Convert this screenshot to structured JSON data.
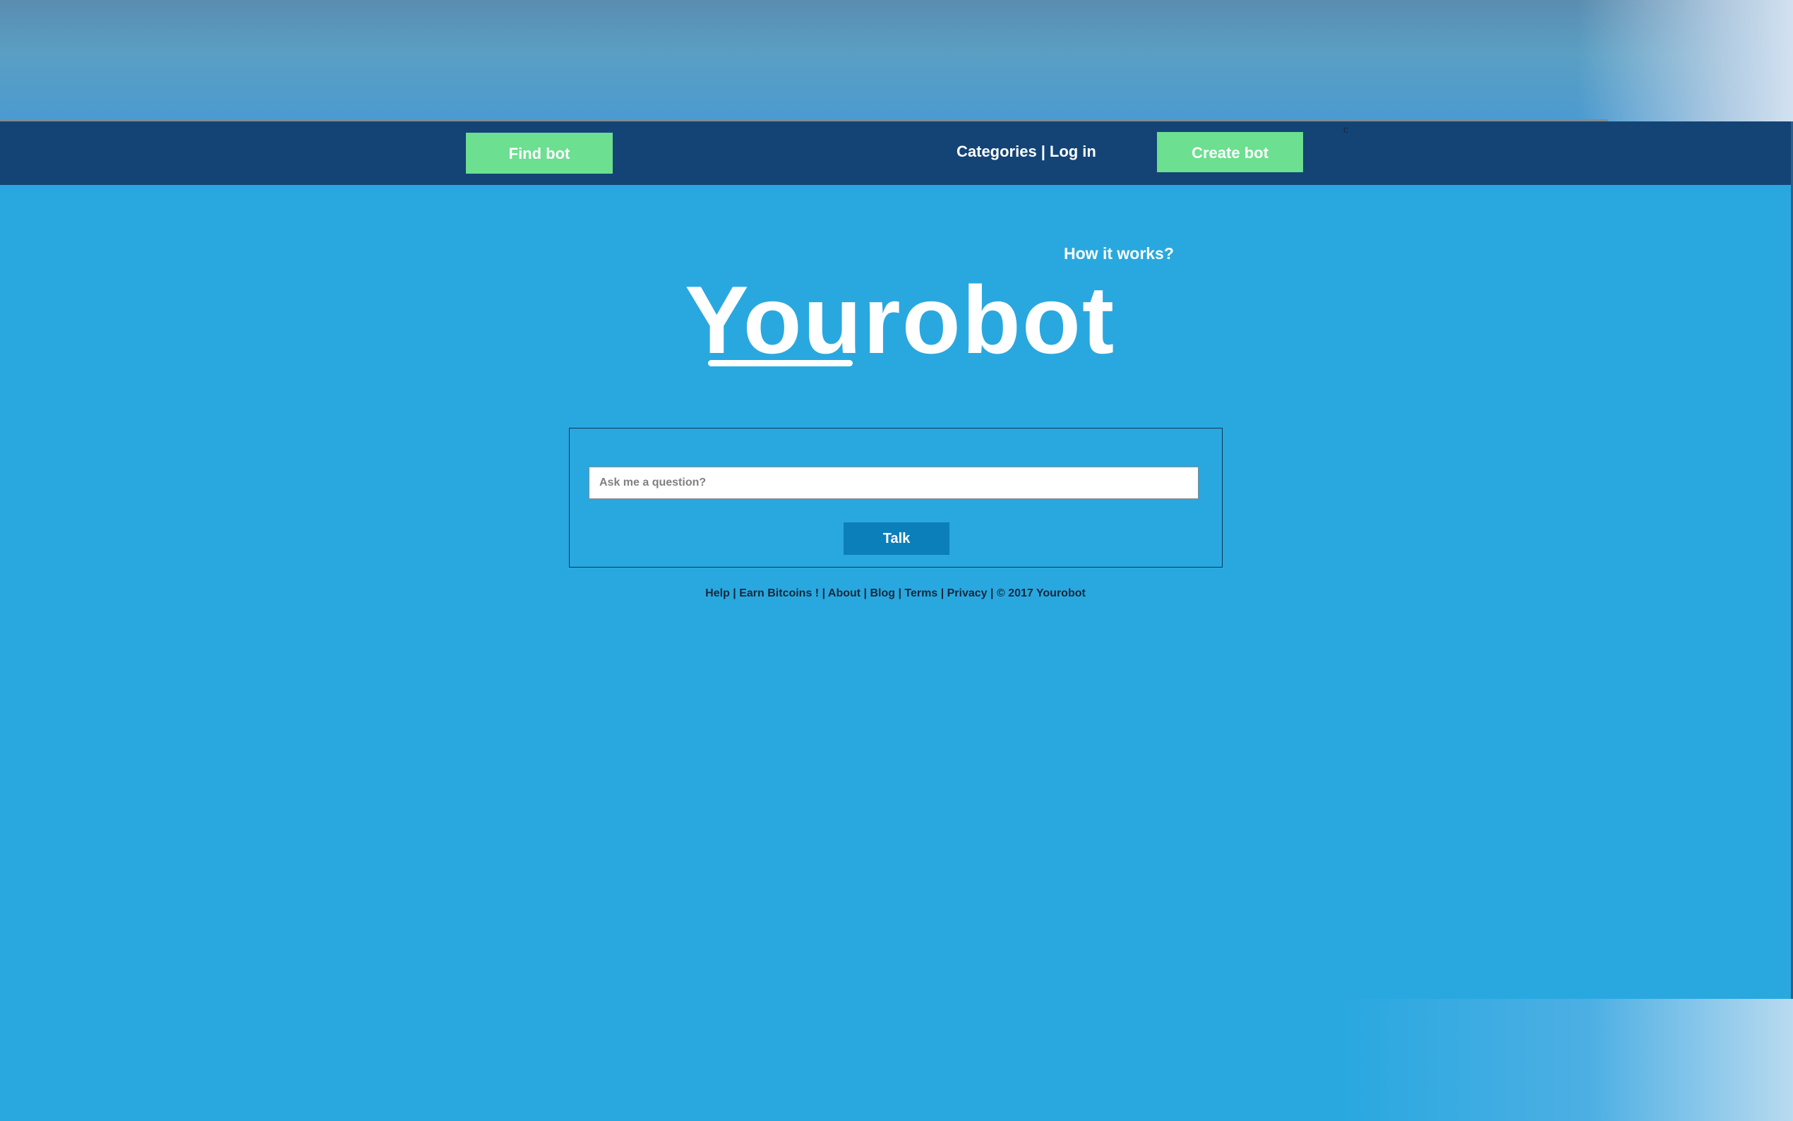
{
  "nav": {
    "find_bot": "Find bot",
    "categories": "Categories",
    "separator": "|",
    "login": "Log in",
    "create_bot": "Create bot",
    "stray_char": "c"
  },
  "hero": {
    "how_it_works": "How it works?",
    "logo": "Yourobot"
  },
  "search": {
    "placeholder": "Ask me a question?",
    "value": "",
    "talk_label": "Talk"
  },
  "footer": {
    "links": [
      "Help",
      "Earn Bitcoins !",
      "About",
      "Blog",
      "Terms",
      "Privacy"
    ],
    "copyright": "© 2017 Yourobot",
    "separator": " | "
  },
  "colors": {
    "page_bg": "#29a8e0",
    "navbar_bg": "#144475",
    "accent_green": "#6cdf90",
    "talk_button": "#0b7fba"
  }
}
